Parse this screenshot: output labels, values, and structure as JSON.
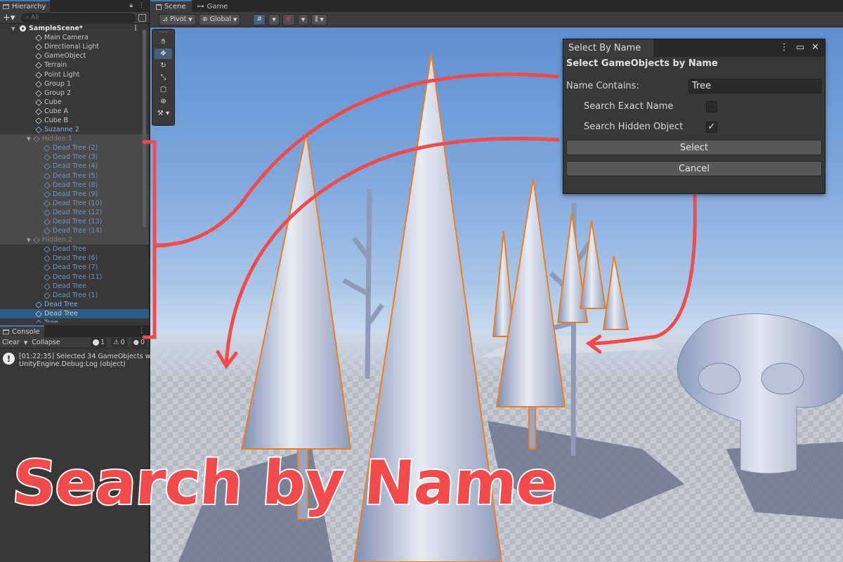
{
  "hierarchy": {
    "tab_label": "Hierarchy",
    "add_label": "+▾",
    "search_placeholder": "All",
    "scene_name": "SampleScene*",
    "items": [
      {
        "label": "Main Camera",
        "style": "normal"
      },
      {
        "label": "Directional Light",
        "style": "normal"
      },
      {
        "label": "GameObject",
        "style": "normal"
      },
      {
        "label": "Terrain",
        "style": "normal"
      },
      {
        "label": "Point Light",
        "style": "normal"
      },
      {
        "label": "Group 1",
        "style": "normal"
      },
      {
        "label": "Group 2",
        "style": "normal"
      },
      {
        "label": "Cube",
        "style": "normal"
      },
      {
        "label": "Cube A",
        "style": "normal"
      },
      {
        "label": "Cube B",
        "style": "normal"
      },
      {
        "label": "Suzanne 2",
        "style": "prefab"
      }
    ],
    "hidden1": {
      "label": "Hidden 1",
      "children": [
        "Dead Tree (2)",
        "Dead Tree (3)",
        "Dead Tree (4)",
        "Dead Tree (5)",
        "Dead Tree (8)",
        "Dead Tree (9)",
        "Dead Tree (10)",
        "Dead Tree (12)",
        "Dead Tree (13)",
        "Dead Tree (14)"
      ]
    },
    "hidden2": {
      "label": "Hidden 2",
      "children": [
        "Dead Tree",
        "Dead Tree (6)",
        "Dead Tree (7)",
        "Dead Tree (11)",
        "Dead Tree",
        "Dead Tree (1)"
      ]
    },
    "tail_items": [
      "Dead Tree",
      "Dead Tree",
      "Tree"
    ]
  },
  "console": {
    "tab_label": "Console",
    "clear_label": "Clear",
    "collapse_label": "Collapse",
    "count_info": "1",
    "count_warn": "0",
    "count_error": "0",
    "message_line1": "[01:22:35] Selected 34 GameObjects w",
    "message_line2": "UnityEngine.Debug:Log (object)"
  },
  "scene": {
    "tab_scene": "Scene",
    "tab_game": "Game",
    "pivot_label": "Pivot",
    "global_label": "Global"
  },
  "dialog": {
    "tab_label": "Select By Name",
    "heading": "Select GameObjects by Name",
    "name_contains_label": "Name Contains:",
    "name_contains_value": "Tree",
    "exact_label": "Search Exact Name",
    "exact_checked": false,
    "hidden_label": "Search Hidden Object",
    "hidden_checked": true,
    "check_mark": "✓",
    "select_label": "Select",
    "cancel_label": "Cancel"
  },
  "overlay_title": "Search by Name",
  "colors": {
    "accent": "#3a79bb",
    "annotation": "#f34a4c",
    "selection_outline": "#f07d22"
  }
}
